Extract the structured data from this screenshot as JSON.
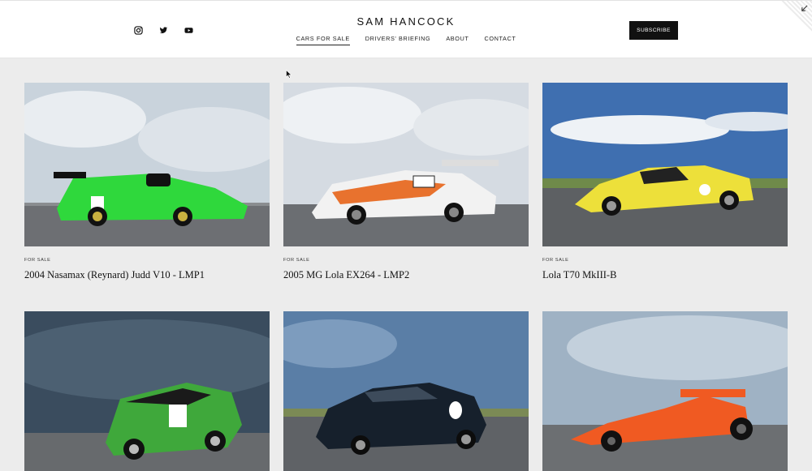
{
  "header": {
    "brand": "SAM HANCOCK",
    "nav": [
      {
        "label": "CARS FOR SALE",
        "active": true
      },
      {
        "label": "DRIVERS' BRIEFING",
        "active": false
      },
      {
        "label": "ABOUT",
        "active": false
      },
      {
        "label": "CONTACT",
        "active": false
      }
    ],
    "subscribe_label": "SUBSCRIBE",
    "social_icons": [
      "instagram-icon",
      "twitter-icon",
      "youtube-icon"
    ]
  },
  "listings": [
    {
      "label": "FOR SALE",
      "title": "2004 Nasamax (Reynard) Judd V10 - LMP1",
      "car_color": "#2fd83c",
      "sky": "#c9d3dc",
      "kind": "prototype"
    },
    {
      "label": "FOR SALE",
      "title": "2005 MG Lola EX264 - LMP2",
      "car_color": "#f2f2f2",
      "sky": "#d5dbe2",
      "kind": "prototype"
    },
    {
      "label": "FOR SALE",
      "title": "Lola T70 MkIII-B",
      "car_color": "#ede03a",
      "sky": "#3f6fb0",
      "kind": "coupe"
    },
    {
      "label": "",
      "title": "",
      "car_color": "#3fa83b",
      "sky": "#3a4c5e",
      "kind": "saloon"
    },
    {
      "label": "",
      "title": "",
      "car_color": "#16202c",
      "sky": "#5a7ea6",
      "kind": "gt"
    },
    {
      "label": "",
      "title": "",
      "car_color": "#f05a22",
      "sky": "#9fb2c4",
      "kind": "formula"
    }
  ],
  "colors": {
    "accent": "#111111",
    "background": "#ececec"
  }
}
